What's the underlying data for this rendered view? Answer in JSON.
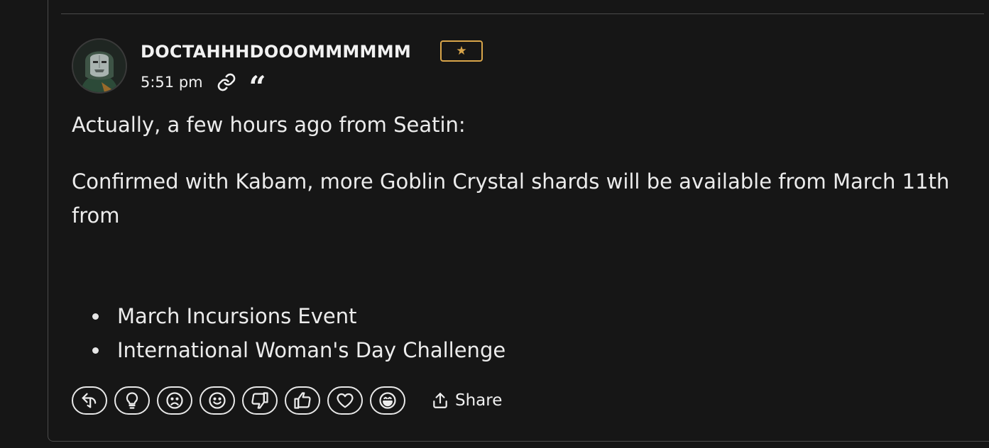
{
  "post": {
    "author": "DOCTAHHHDOOOMMMMMM",
    "rank_badge": "★",
    "timestamp": "5:51 pm",
    "paragraphs": [
      "Actually, a few hours ago from Seatin:",
      "Confirmed with Kabam, more Goblin Crystal shards will be available from March 11th from"
    ],
    "bullets": [
      "March Incursions Event",
      "International Woman's Day Challenge"
    ],
    "icons": {
      "permalink": "link-icon",
      "quote": "quote-icon"
    }
  },
  "reactions": [
    "reply-icon",
    "insightful-icon",
    "sad-icon",
    "smile-icon",
    "dislike-icon",
    "like-icon",
    "love-icon",
    "laugh-icon"
  ],
  "share": {
    "label": "Share"
  },
  "colors": {
    "background": "#161616",
    "text": "#ececec",
    "badge_gold": "#d9a54a",
    "divider": "#4a4a4a"
  }
}
